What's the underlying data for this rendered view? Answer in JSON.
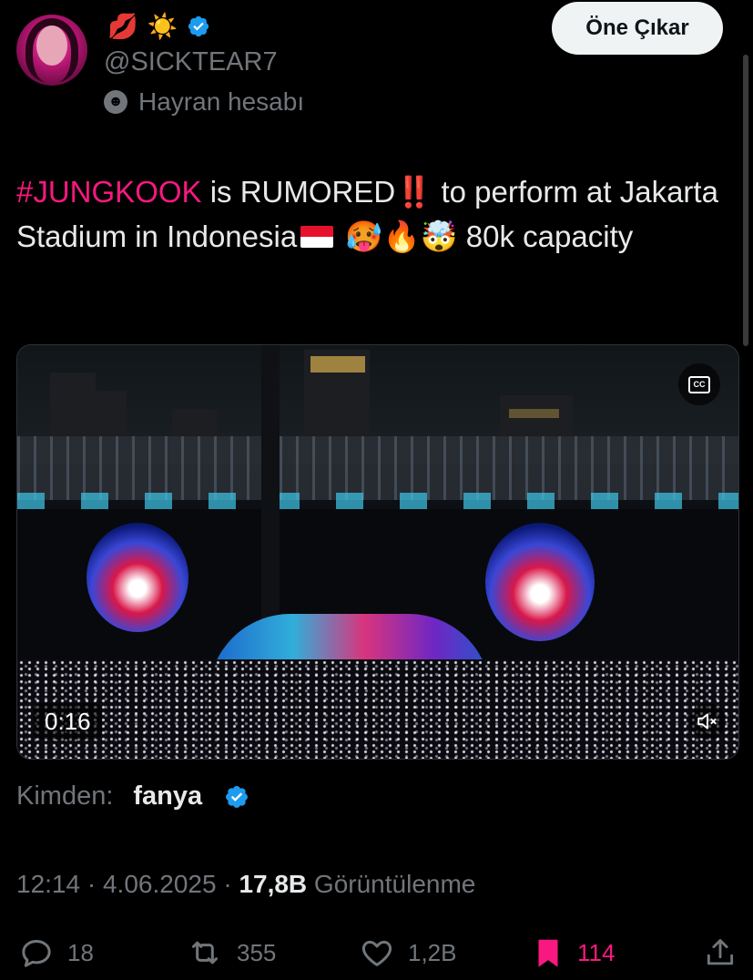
{
  "header": {
    "emojis": [
      "💋",
      "☀️"
    ],
    "handle": "@SICKTEAR7",
    "account_label": "Hayran hesabı",
    "promote_button": "Öne Çıkar"
  },
  "tweet": {
    "hashtag": "#JUNGKOOK",
    "text_part1": " is RUMORED",
    "double_exclamation": "‼️",
    "text_part2": " to perform at Jakarta Stadium in Indonesia",
    "emoji_after_flag": " 🥵🔥🤯",
    "text_part3": " 80k capacity"
  },
  "video": {
    "timestamp": "0:16",
    "cc_label": "CC"
  },
  "source": {
    "label": "Kimden:",
    "name": "fanya"
  },
  "meta": {
    "time": "12:14",
    "separator": " · ",
    "date": "4.06.2025",
    "views_count": "17,8B",
    "views_label": " Görüntülenme"
  },
  "actions": {
    "replies": "18",
    "reposts": "355",
    "likes": "1,2B",
    "bookmarks": "114"
  },
  "colors": {
    "accent_pink": "#f91880",
    "verified_blue": "#1d9bf0",
    "muted_text": "#71767b"
  },
  "icons": {
    "verified": "verified-badge-icon",
    "mask": "mask-icon",
    "cc": "closed-captions-icon",
    "mute": "mute-icon",
    "reply": "reply-icon",
    "retweet": "retweet-icon",
    "like": "heart-icon",
    "bookmark": "bookmark-icon",
    "share": "share-icon"
  }
}
